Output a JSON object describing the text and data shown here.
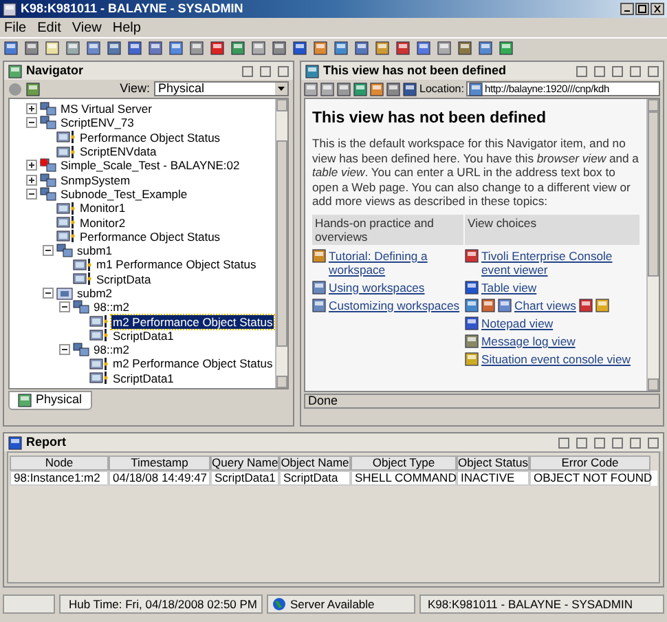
{
  "window": {
    "title": "K98:K981011 - BALAYNE - SYSADMIN"
  },
  "menu": [
    "File",
    "Edit",
    "View",
    "Help"
  ],
  "navigator": {
    "title": "Navigator",
    "view_label": "View:",
    "view_value": "Physical",
    "tree": [
      {
        "label": "MS Virtual Server",
        "kind": "system",
        "expanded": false
      },
      {
        "label": "ScriptENV_73",
        "kind": "system",
        "expanded": true,
        "children": [
          {
            "label": "Performance Object Status",
            "kind": "item",
            "selected": false
          },
          {
            "label": "ScriptENVdata",
            "kind": "item",
            "selected": false
          }
        ]
      },
      {
        "label": "Simple_Scale_Test - BALAYNE:02",
        "kind": "alert",
        "expanded": false
      },
      {
        "label": "SnmpSystem",
        "kind": "system",
        "expanded": false
      },
      {
        "label": "Subnode_Test_Example",
        "kind": "system",
        "expanded": true,
        "children": [
          {
            "label": "Monitor1",
            "kind": "item",
            "selected": false
          },
          {
            "label": "Monitor2",
            "kind": "item",
            "selected": false
          },
          {
            "label": "Performance Object Status",
            "kind": "item",
            "selected": false
          },
          {
            "label": "subm1",
            "kind": "system",
            "expanded": true,
            "children": [
              {
                "label": "m1 Performance Object Status",
                "kind": "item",
                "selected": false
              },
              {
                "label": "ScriptData",
                "kind": "item",
                "selected": false
              }
            ]
          },
          {
            "label": "subm2",
            "kind": "folder",
            "expanded": true,
            "children": [
              {
                "label": "98::m2",
                "kind": "system",
                "expanded": true,
                "children": [
                  {
                    "label": "m2 Performance Object Status",
                    "kind": "item",
                    "selected": true
                  },
                  {
                    "label": "ScriptData1",
                    "kind": "item",
                    "selected": false
                  }
                ]
              },
              {
                "label": "98::m2",
                "kind": "system",
                "expanded": true,
                "children": [
                  {
                    "label": "m2 Performance Object Status",
                    "kind": "item",
                    "selected": false
                  },
                  {
                    "label": "ScriptData1",
                    "kind": "item",
                    "selected": false
                  }
                ]
              }
            ]
          }
        ]
      }
    ],
    "tab": "Physical"
  },
  "browser": {
    "title": "This view has not been defined",
    "location_label": "Location:",
    "location": "http://balayne:1920///cnp/kdh",
    "heading": "This view has not been defined",
    "paragraph": "This is the default workspace for this Navigator item, and no view has been defined here. You have this *browser view* and a *table view*. You can enter a URL in the address text box to open a Web page. You can also change to a different view or add more views as described in these topics:",
    "columns": [
      {
        "header": "Hands-on practice and overviews",
        "links": [
          {
            "text": "Tutorial: Defining a workspace"
          },
          {
            "text": "Using workspaces"
          },
          {
            "text": "Customizing workspaces"
          }
        ]
      },
      {
        "header": "View choices",
        "links": [
          {
            "text": "Tivoli Enterprise Console event viewer"
          },
          {
            "text": "Table view"
          },
          {
            "text": "Chart views"
          },
          {
            "text": "Notepad view"
          },
          {
            "text": "Message log view"
          },
          {
            "text": "Situation event console view"
          }
        ]
      }
    ],
    "status": "Done"
  },
  "report": {
    "title": "Report",
    "columns": [
      "Node",
      "Timestamp",
      "Query Name",
      "Object Name",
      "Object Type",
      "Object Status",
      "Error Code"
    ],
    "rows": [
      [
        "98:Instance1:m2",
        "04/18/08 14:49:47",
        "ScriptData1",
        "ScriptData",
        "SHELL COMMAND",
        "INACTIVE",
        "OBJECT NOT FOUND"
      ]
    ]
  },
  "status_bar": {
    "hub_time": "Hub Time: Fri, 04/18/2008 02:50 PM",
    "server": "Server Available",
    "user": "K98:K981011 - BALAYNE - SYSADMIN"
  }
}
